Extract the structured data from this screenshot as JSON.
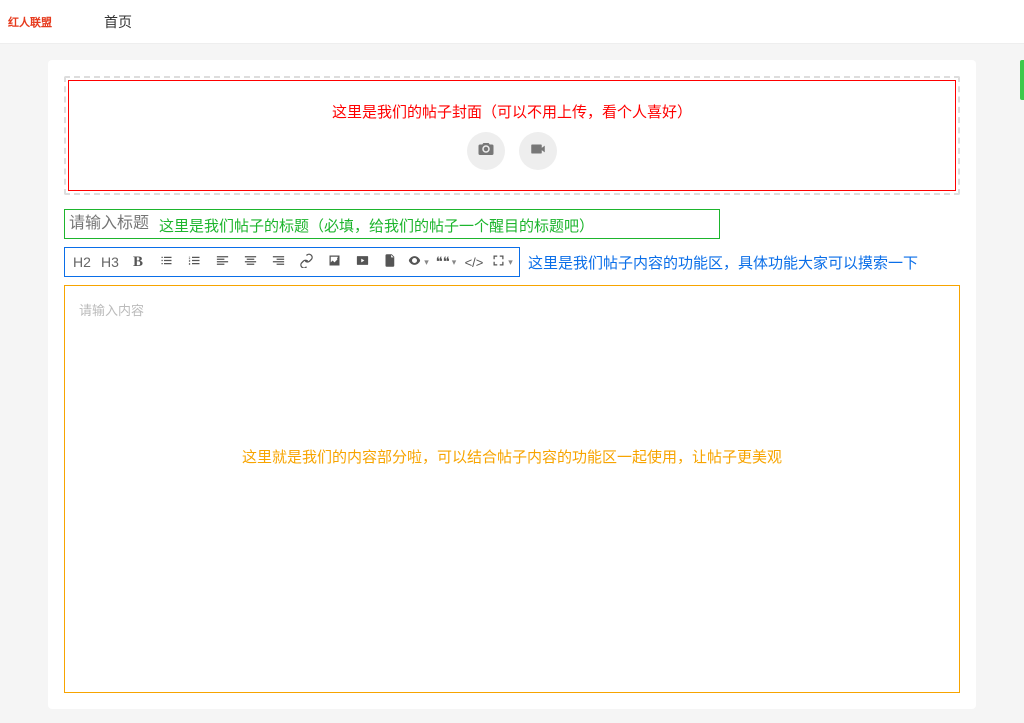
{
  "header": {
    "logo_text": "红人联盟",
    "nav_home": "首页"
  },
  "cover": {
    "annotation": "这里是我们的帖子封面（可以不用上传，看个人喜好）"
  },
  "title": {
    "placeholder": "请输入标题",
    "annotation": "这里是我们帖子的标题（必填，给我们的帖子一个醒目的标题吧）"
  },
  "toolbar": {
    "h2": "H2",
    "h3": "H3",
    "bold": "B",
    "quote": "❝❝",
    "code": "</>",
    "annotation": "这里是我们帖子内容的功能区，具体功能大家可以摸索一下"
  },
  "content": {
    "placeholder": "请输入内容",
    "annotation": "这里就是我们的内容部分啦，可以结合帖子内容的功能区一起使用，让帖子更美观"
  },
  "colors": {
    "cover_border": "#ff0000",
    "title_border": "#1db52d",
    "toolbar_border": "#0a6ee8",
    "content_border": "#f7a400"
  }
}
